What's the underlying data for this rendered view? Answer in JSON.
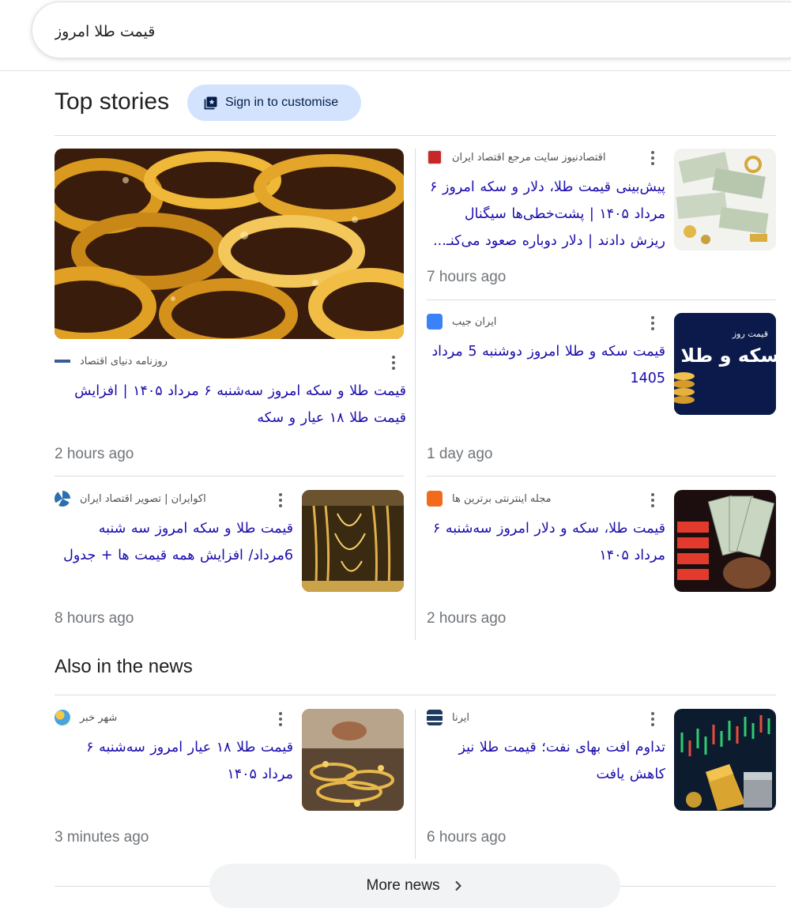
{
  "search": {
    "query": "قیمت طلا امروز"
  },
  "top_stories": {
    "title": "Top stories",
    "signin_label": "Sign in to customise"
  },
  "also": {
    "title": "Also in the news"
  },
  "stories": [
    {
      "source": "روزنامه دنیای اقتصاد",
      "headline": "قیمت طلا و سکه امروز سه‌شنبه ۶ مرداد ۱۴۰۵ | افزایش قیمت طلا ۱۸ عیار و سکه",
      "time": "2 hours ago",
      "favicon": "dunya-eqtesad-icon",
      "thumb": "gold-bangles-image"
    },
    {
      "source": "اقتصادنیوز سایت مرجع اقتصاد ایران",
      "headline": "پیش‌بینی قیمت طلا، دلار و سکه امروز ۶ مرداد ۱۴۰۵ | پشت‌خطی‌ها سیگنال ریزش دادند | دلار دوباره صعود می‌کنـ...",
      "time": "7 hours ago",
      "favicon": "eghtesadnews-icon",
      "thumb": "dollars-gold-image"
    },
    {
      "source": "ایران جیب",
      "headline": "قیمت سکه و طلا امروز دوشنبه 5 مرداد 1405",
      "time": "1 day ago",
      "favicon": "iranjib-icon",
      "thumb": "coin-gold-banner-image",
      "thumb_text_top": "قیمت روز",
      "thumb_text_main": "سکه و طلا"
    },
    {
      "source": "اکوایران | تصویر اقتصاد ایران",
      "headline": "قیمت طلا و سکه امروز سه شنبه 6مرداد/ افزایش همه قیمت ها + جدول",
      "time": "8 hours ago",
      "favicon": "ecoiran-icon",
      "thumb": "gold-necklaces-image"
    },
    {
      "source": "مجله اینترنتی برترین ها",
      "headline": "قیمت طلا، سکه و دلار امروز سه‌شنبه ۶ مرداد ۱۴۰۵",
      "time": "2 hours ago",
      "favicon": "bartarinha-icon",
      "thumb": "dollar-board-image"
    },
    {
      "source": "شهر خبر",
      "headline": "قیمت طلا ۱۸ عیار امروز سه‌شنبه ۶ مرداد ۱۴۰۵",
      "time": "3 minutes ago",
      "favicon": "shahrekhabar-icon",
      "thumb": "gold-jewelry-hand-image"
    },
    {
      "source": "ایرنا",
      "headline": "تداوم افت بهای نفت؛ قیمت طلا نیز کاهش یافت",
      "time": "6 hours ago",
      "favicon": "irna-icon",
      "thumb": "gold-bars-chart-image"
    }
  ],
  "more_news_label": "More news",
  "colors": {
    "link": "#1a0dab",
    "time": "#70757a",
    "signin_bg": "#d3e3fd",
    "divider": "#dadce0"
  }
}
